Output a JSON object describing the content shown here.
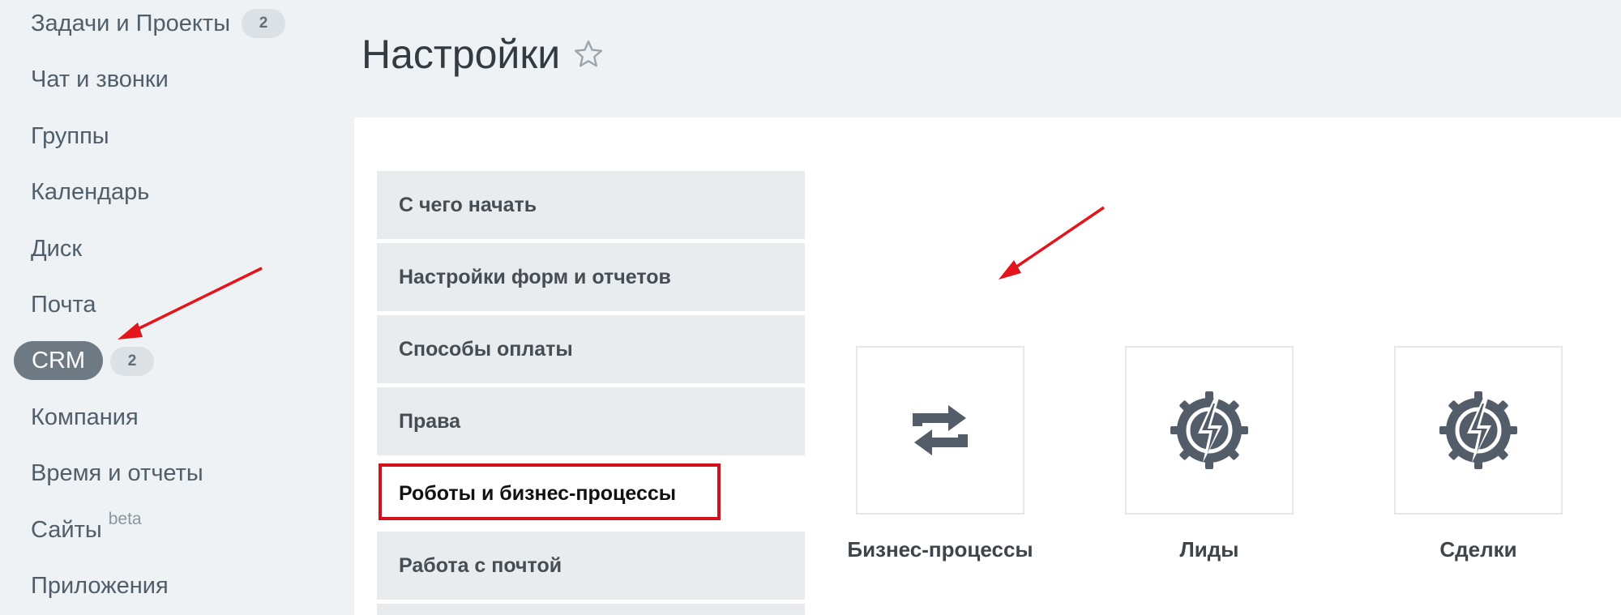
{
  "sidebar": {
    "items": [
      {
        "label": "Задачи и Проекты",
        "counter": "2"
      },
      {
        "label": "Чат и звонки"
      },
      {
        "label": "Группы"
      },
      {
        "label": "Календарь"
      },
      {
        "label": "Диск"
      },
      {
        "label": "Почта"
      },
      {
        "label": "CRM",
        "counter": "2"
      },
      {
        "label": "Компания"
      },
      {
        "label": "Время и отчеты"
      },
      {
        "label": "Сайты",
        "badge": "beta"
      },
      {
        "label": "Приложения"
      }
    ]
  },
  "header": {
    "title": "Настройки",
    "star_icon": "star-outline-icon"
  },
  "settings_menu": {
    "items": [
      {
        "label": "С чего начать"
      },
      {
        "label": "Настройки форм и отчетов"
      },
      {
        "label": "Способы оплаты"
      },
      {
        "label": "Права"
      },
      {
        "label": "Роботы и бизнес-процессы",
        "selected": true
      },
      {
        "label": "Работа с почтой"
      }
    ]
  },
  "tiles": [
    {
      "label": "Бизнес-процессы",
      "icon": "refresh-arrows-icon"
    },
    {
      "label": "Лиды",
      "icon": "gear-lightning-icon"
    },
    {
      "label": "Сделки",
      "icon": "gear-lightning-icon"
    }
  ],
  "colors": {
    "sidebar_bg": "#eef2f4",
    "active_pill": "#6e7a83",
    "menu_item_bg": "#e8ecef",
    "highlight_frame": "#d3101c",
    "annotation_arrow": "#e3141c",
    "icon_color": "#535c69"
  }
}
